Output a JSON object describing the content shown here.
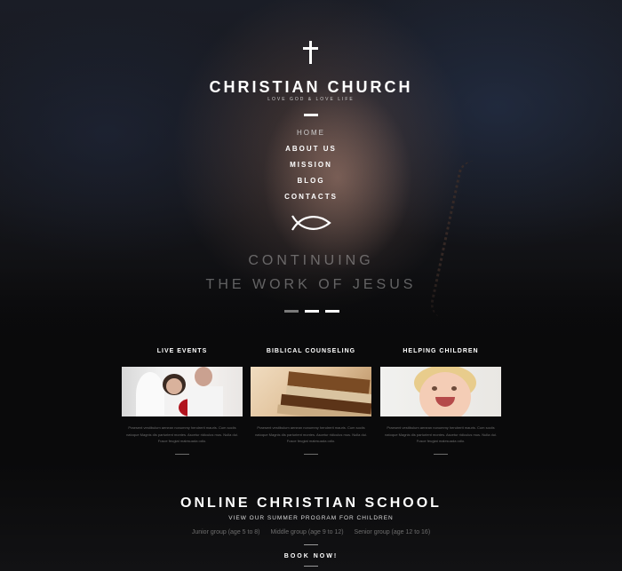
{
  "header": {
    "title": "CHRISTIAN CHURCH",
    "tagline": "LOVE GOD & LOVE LIFE"
  },
  "nav": {
    "items": [
      "HOME",
      "ABOUT US",
      "MISSION",
      "BLOG",
      "CONTACTS"
    ]
  },
  "hero": {
    "line1": "CONTINUING",
    "line2": "THE WORK OF JESUS",
    "active_slide": 2,
    "slide_count": 3
  },
  "features": [
    {
      "title": "LIVE EVENTS",
      "text": "Praesent vestibulum aenean nonummy hendrerit mauris. Cum sociis natoque Magnis dis parturient montes. Ascetur ridiculus mus. Nulla dui. Fusce feugiat malesuada odio."
    },
    {
      "title": "BIBLICAL COUNSELING",
      "text": "Praesent vestibulum aenean nonummy hendrerit mauris. Cum sociis natoque Magnis dis parturient montes. Ascetur ridiculus mus. Nulla dui. Fusce feugiat malesuada odio."
    },
    {
      "title": "HELPING CHILDREN",
      "text": "Praesent vestibulum aenean nonummy hendrerit mauris. Cum sociis natoque Magnis dis parturient montes. Ascetur ridiculus mus. Nulla dui. Fusce feugiat malesuada odio."
    }
  ],
  "school": {
    "title": "ONLINE CHRISTIAN SCHOOL",
    "subtitle": "VIEW OUR SUMMER PROGRAM FOR CHILDREN",
    "groups": [
      "Junior group (age 5 to 8)",
      "Middle group (age 9 to 12)",
      "Senior group (age 12 to 16)"
    ],
    "cta": "BOOK NOW!"
  },
  "colors": {
    "background": "#0a0a0b",
    "text_primary": "#ffffff",
    "text_muted": "#6d6d6d"
  }
}
